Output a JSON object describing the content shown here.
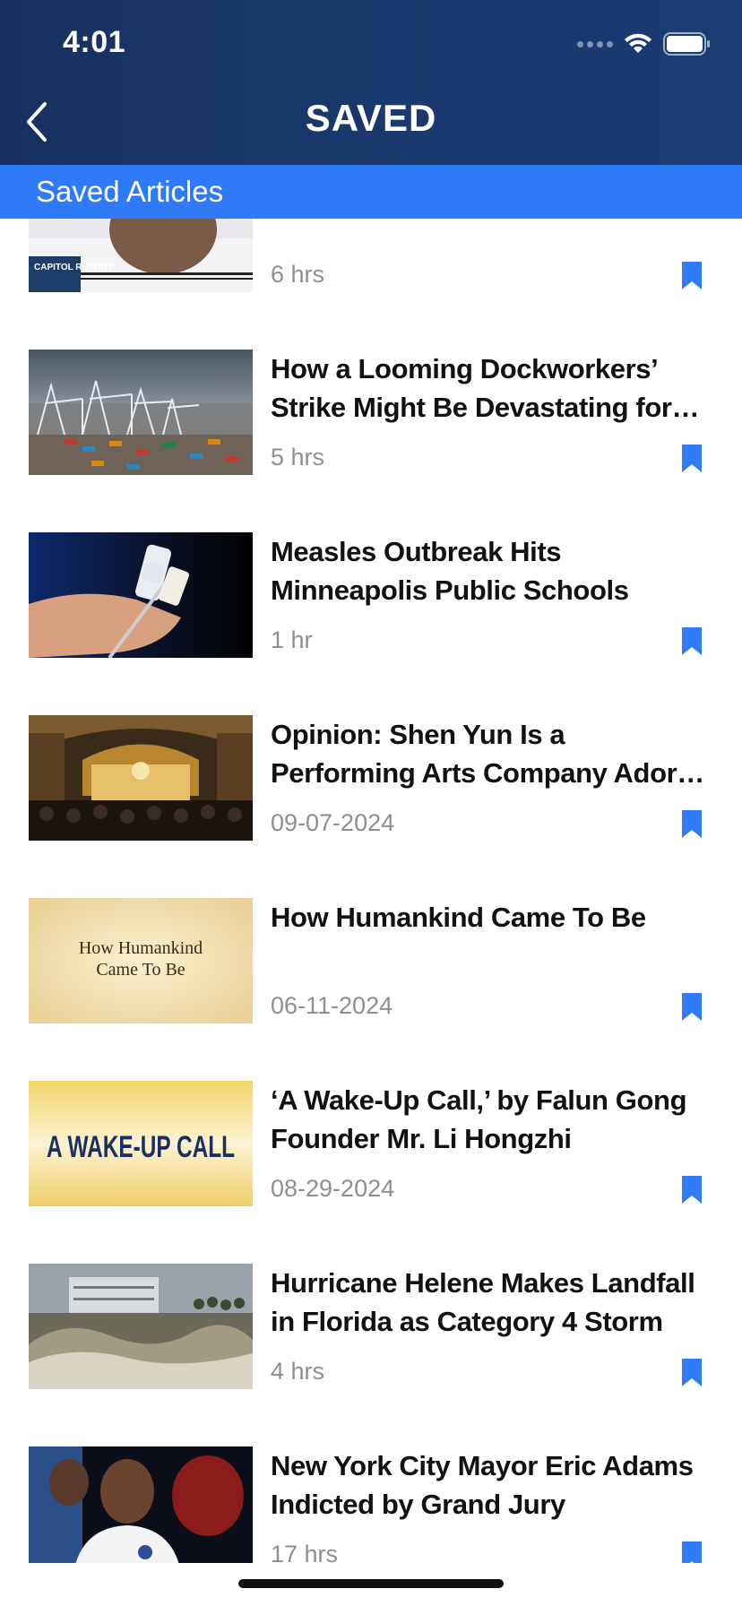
{
  "status": {
    "time": "4:01"
  },
  "header": {
    "title": "SAVED"
  },
  "section": {
    "label": "Saved Articles"
  },
  "articles": [
    {
      "title": "",
      "time": "6 hrs",
      "thumb_text": "CAPITOL REPORT"
    },
    {
      "title": "How a Looming Dockworkers’ Strike Might Be Devastating for the Econ...",
      "time": "5 hrs"
    },
    {
      "title": "Measles Outbreak Hits Minneapolis Public Schools",
      "time": "1 hr"
    },
    {
      "title": "Opinion: Shen Yun Is a Performing Arts Company Adored by Millions,...",
      "time": "09-07-2024"
    },
    {
      "title": "How Humankind Came To Be",
      "time": "06-11-2024",
      "thumb_line1": "How Humankind",
      "thumb_line2": "Came To Be"
    },
    {
      "title": "‘A Wake-Up Call,’ by Falun Gong Founder Mr. Li Hongzhi",
      "time": "08-29-2024",
      "thumb_text": "A WAKE-UP CALL"
    },
    {
      "title": "Hurricane Helene Makes Landfall in Florida as Category 4 Storm",
      "time": "4 hrs"
    },
    {
      "title": "New York City Mayor Eric Adams Indicted by Grand Jury",
      "time": "17 hrs"
    }
  ],
  "colors": {
    "header": "#1a3a6f",
    "accent": "#2f7af7"
  }
}
